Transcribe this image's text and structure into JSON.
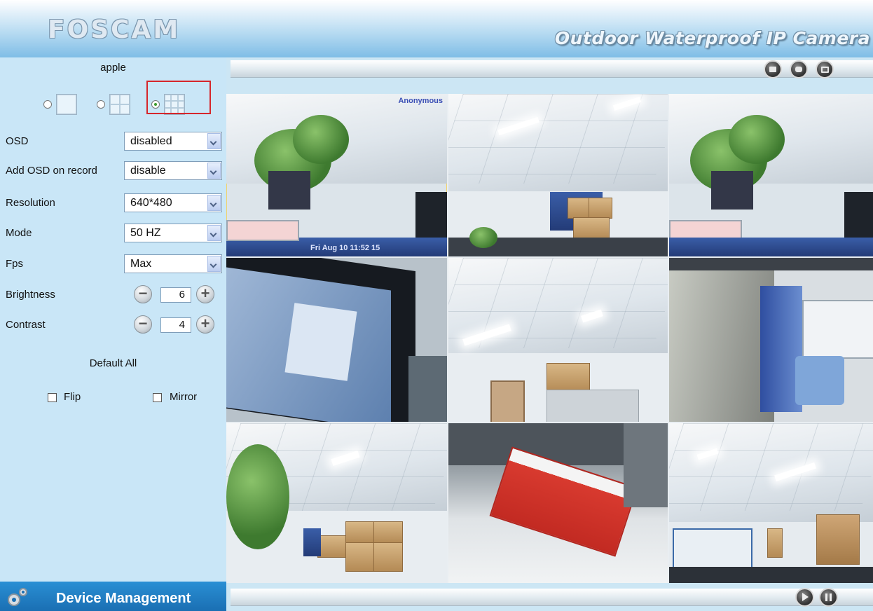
{
  "header": {
    "brand": "FOSCAM",
    "tagline": "Outdoor Waterproof IP Camera"
  },
  "sidebar": {
    "username": "apple",
    "layout_options": [
      {
        "id": "1-view",
        "selected": false
      },
      {
        "id": "4-view",
        "selected": false
      },
      {
        "id": "9-view",
        "selected": true
      }
    ],
    "fields": [
      {
        "label": "OSD",
        "value": "disabled"
      },
      {
        "label": "Add OSD on record",
        "value": "disable"
      },
      {
        "label": "Resolution",
        "value": "640*480"
      },
      {
        "label": "Mode",
        "value": "50 HZ"
      },
      {
        "label": "Fps",
        "value": "Max"
      }
    ],
    "brightness": {
      "label": "Brightness",
      "value": "6"
    },
    "contrast": {
      "label": "Contrast",
      "value": "4"
    },
    "default_all": "Default All",
    "flip": {
      "label": "Flip",
      "checked": false
    },
    "mirror": {
      "label": "Mirror",
      "checked": false
    },
    "device_management": "Device Management"
  },
  "toolbar": {
    "icons": [
      "record-icon",
      "snapshot-icon",
      "fullscreen-icon"
    ]
  },
  "video": {
    "feeds": 9,
    "osd_text": "Anonymous",
    "osd_time": "Fri Aug 10 11:52 15"
  },
  "bottombar": {
    "icons": [
      "play-icon",
      "stop-icon"
    ]
  },
  "colors": {
    "sidebar_bg": "#c9e6f7",
    "header_accent": "#7fbde6",
    "device_management_bg": "#1a6fb3",
    "highlight": "#d6262b"
  }
}
